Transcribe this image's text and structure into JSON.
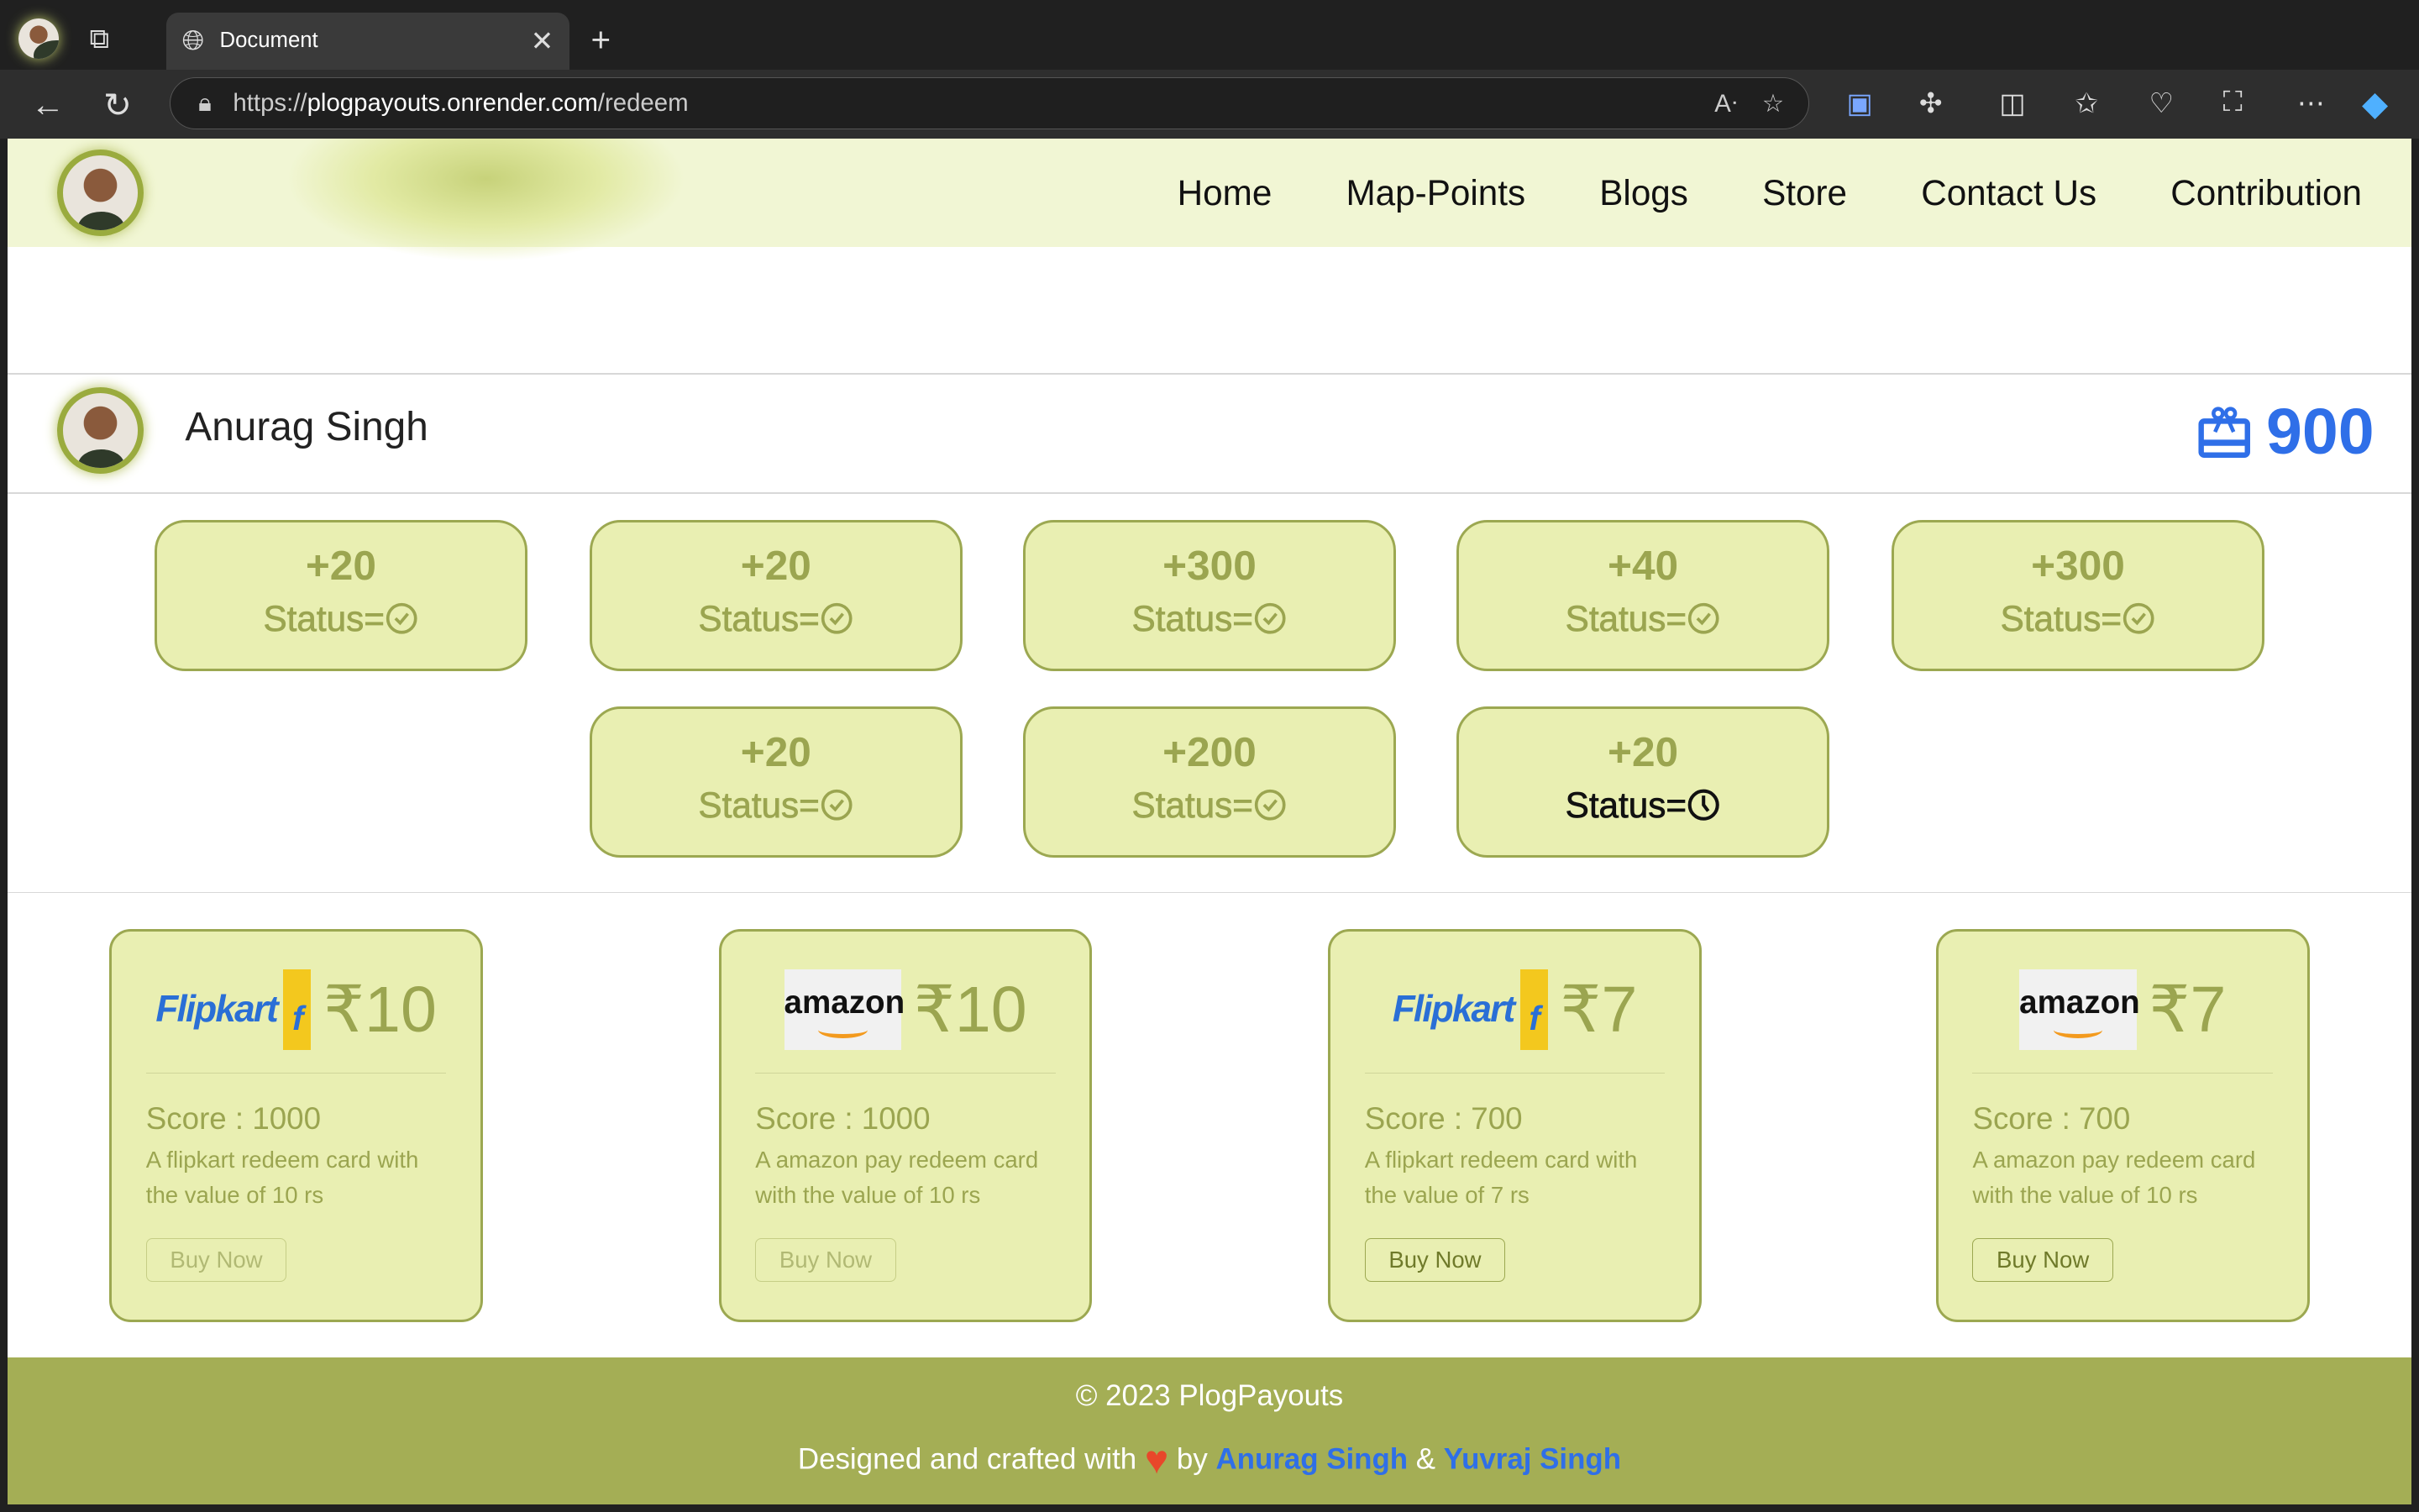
{
  "browser": {
    "tab_title": "Document",
    "url_scheme": "https://",
    "url_host": "plogpayouts.onrender.com",
    "url_path": "/redeem"
  },
  "nav": {
    "items": [
      "Home",
      "Map-Points",
      "Blogs",
      "Store",
      "Contact Us",
      "Contribution"
    ]
  },
  "profile": {
    "name": "Anurag Singh",
    "points": "900"
  },
  "activities": [
    {
      "points": "+20",
      "status_label": "Status=",
      "status": "approved"
    },
    {
      "points": "+20",
      "status_label": "Status=",
      "status": "approved"
    },
    {
      "points": "+300",
      "status_label": "Status=",
      "status": "approved"
    },
    {
      "points": "+40",
      "status_label": "Status=",
      "status": "approved"
    },
    {
      "points": "+300",
      "status_label": "Status=",
      "status": "approved"
    },
    {
      "points": "+20",
      "status_label": "Status=",
      "status": "approved"
    },
    {
      "points": "+200",
      "status_label": "Status=",
      "status": "approved"
    },
    {
      "points": "+20",
      "status_label": "Status=",
      "status": "pending"
    }
  ],
  "store": [
    {
      "brand": "Flipkart",
      "price": "₹10",
      "score": "Score : 1000",
      "desc": "A flipkart redeem card with the value of 10 rs",
      "button": "Buy Now",
      "enabled": false
    },
    {
      "brand": "amazon",
      "price": "₹10",
      "score": "Score : 1000",
      "desc": "A amazon pay redeem card with the value of 10 rs",
      "button": "Buy Now",
      "enabled": false
    },
    {
      "brand": "Flipkart",
      "price": "₹7",
      "score": "Score : 700",
      "desc": "A flipkart redeem card with the value of 7 rs",
      "button": "Buy Now",
      "enabled": true
    },
    {
      "brand": "amazon",
      "price": "₹7",
      "score": "Score : 700",
      "desc": "A amazon pay redeem card with the value of 10 rs",
      "button": "Buy Now",
      "enabled": true
    }
  ],
  "footer": {
    "copyright": "© 2023 PlogPayouts",
    "crafted": "Designed and crafted with",
    "by": "by",
    "author1": "Anurag Singh",
    "amp": "&",
    "author2": "Yuvraj Singh"
  },
  "colors": {
    "accent": "#9ca851",
    "card_bg": "#e9efb2",
    "points_blue": "#2f6fe8",
    "footer_bg": "#a4ae55"
  }
}
